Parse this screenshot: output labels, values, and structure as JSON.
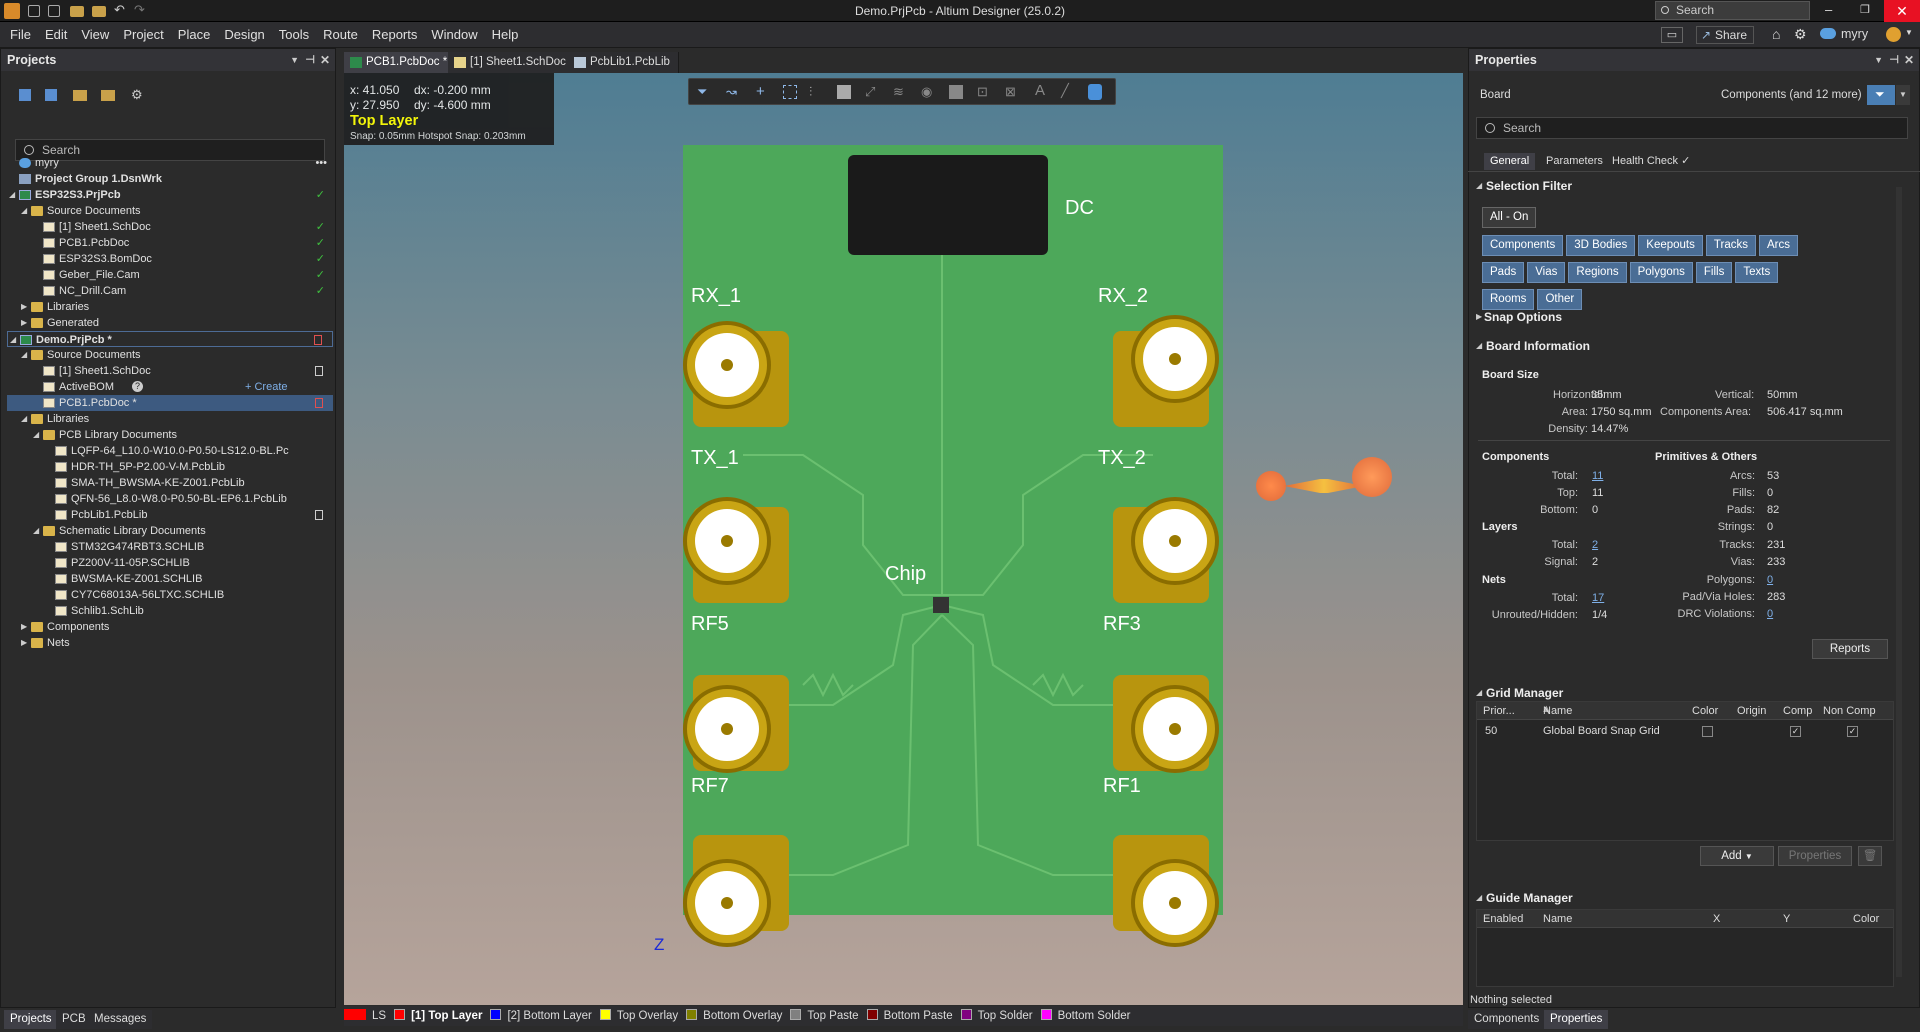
{
  "window": {
    "title": "Demo.PrjPcb - Altium Designer (25.0.2)",
    "search_placeholder": "Search"
  },
  "header_right": {
    "share_label": "Share",
    "user": "myry"
  },
  "menu": [
    "File",
    "Edit",
    "View",
    "Project",
    "Place",
    "Design",
    "Tools",
    "Route",
    "Reports",
    "Window",
    "Help"
  ],
  "projects_panel": {
    "title": "Projects",
    "search_placeholder": "Search",
    "tree": [
      {
        "label": "myry",
        "level": 0
      },
      {
        "label": "Project Group 1.DsnWrk",
        "level": 0
      },
      {
        "label": "ESP32S3.PrjPcb",
        "level": 0
      },
      {
        "label": "Source Documents",
        "level": 1
      },
      {
        "label": "[1] Sheet1.SchDoc",
        "level": 2
      },
      {
        "label": "PCB1.PcbDoc",
        "level": 2
      },
      {
        "label": "ESP32S3.BomDoc",
        "level": 2
      },
      {
        "label": "Geber_File.Cam",
        "level": 2
      },
      {
        "label": "NC_Drill.Cam",
        "level": 2
      },
      {
        "label": "Libraries",
        "level": 1
      },
      {
        "label": "Generated",
        "level": 1
      },
      {
        "label": "Demo.PrjPcb *",
        "level": 0
      },
      {
        "label": "Source Documents",
        "level": 1
      },
      {
        "label": "[1] Sheet1.SchDoc",
        "level": 2
      },
      {
        "label": "ActiveBOM",
        "level": 2
      },
      {
        "label": "PCB1.PcbDoc *",
        "level": 2
      },
      {
        "label": "Libraries",
        "level": 1
      },
      {
        "label": "PCB Library Documents",
        "level": 2
      },
      {
        "label": "LQFP-64_L10.0-W10.0-P0.50-LS12.0-BL.Pc",
        "level": 3
      },
      {
        "label": "HDR-TH_5P-P2.00-V-M.PcbLib",
        "level": 3
      },
      {
        "label": "SMA-TH_BWSMA-KE-Z001.PcbLib",
        "level": 3
      },
      {
        "label": "QFN-56_L8.0-W8.0-P0.50-BL-EP6.1.PcbLib",
        "level": 3
      },
      {
        "label": "PcbLib1.PcbLib",
        "level": 3
      },
      {
        "label": "Schematic Library Documents",
        "level": 2
      },
      {
        "label": "STM32G474RBT3.SCHLIB",
        "level": 3
      },
      {
        "label": "PZ200V-11-05P.SCHLIB",
        "level": 3
      },
      {
        "label": "BWSMA-KE-Z001.SCHLIB",
        "level": 3
      },
      {
        "label": "CY7C68013A-56LTXC.SCHLIB",
        "level": 3
      },
      {
        "label": "Schlib1.SchLib",
        "level": 3
      },
      {
        "label": "Components",
        "level": 1
      },
      {
        "label": "Nets",
        "level": 1
      }
    ],
    "create_label": "+ Create"
  },
  "doc_tabs": [
    "PCB1.PcbDoc *",
    "[1] Sheet1.SchDoc",
    "PcbLib1.PcbLib"
  ],
  "hud": {
    "x": "x: 41.050",
    "dx": "dx: -0.200  mm",
    "y": "y: 27.950",
    "dy": "dy: -4.600  mm",
    "layer": "Top Layer",
    "snap": "Snap: 0.05mm Hotspot Snap: 0.203mm"
  },
  "pcb": {
    "labels": [
      "DC",
      "RX_1",
      "RX_2",
      "TX_1",
      "TX_2",
      "Chip",
      "RF5",
      "RF3",
      "RF7",
      "RF1"
    ],
    "axis": "Z"
  },
  "layers": [
    "LS",
    "[1] Top Layer",
    "[2] Bottom Layer",
    "Top Overlay",
    "Bottom Overlay",
    "Top Paste",
    "Bottom Paste",
    "Top Solder",
    "Bottom Solder"
  ],
  "layer_colors": [
    "#ff0000",
    "#ff0000",
    "#0000ff",
    "#ffff00",
    "#808000",
    "#808080",
    "#800000",
    "#800080",
    "#ff00ff"
  ],
  "bottom_tabs_left": [
    "Projects",
    "PCB",
    "Messages"
  ],
  "properties": {
    "title": "Properties",
    "object": "Board",
    "filter_summary": "Components (and 12 more)",
    "search_placeholder": "Search",
    "tabs": [
      "General",
      "Parameters",
      "Health Check"
    ],
    "selection_filter": "Selection Filter",
    "all_on": "All - On",
    "filters": [
      "Components",
      "3D Bodies",
      "Keepouts",
      "Tracks",
      "Arcs",
      "Pads",
      "Vias",
      "Regions",
      "Polygons",
      "Fills",
      "Texts",
      "Rooms",
      "Other"
    ],
    "snap_options": "Snap Options",
    "board_info": "Board Information",
    "board_size": "Board Size",
    "horizontal_label": "Horizontal:",
    "horizontal": "35mm",
    "vertical_label": "Vertical:",
    "vertical": "50mm",
    "area_label": "Area:",
    "area": "1750 sq.mm",
    "comp_area_label": "Components Area:",
    "comp_area": "506.417 sq.mm",
    "density_label": "Density:",
    "density": "14.47%",
    "components": "Components",
    "prims": "Primitives & Others",
    "total_label": "Total:",
    "comp_total": "11",
    "top_label": "Top:",
    "comp_top": "11",
    "bottom_label": "Bottom:",
    "comp_bottom": "0",
    "layers": "Layers",
    "layers_total": "2",
    "signal_label": "Signal:",
    "layers_signal": "2",
    "nets": "Nets",
    "nets_total": "17",
    "unrouted_label": "Unrouted/Hidden:",
    "unrouted": "1/4",
    "arcs_label": "Arcs:",
    "arcs": "53",
    "fills_label": "Fills:",
    "fills": "0",
    "pads_label": "Pads:",
    "pads": "82",
    "strings_label": "Strings:",
    "strings": "0",
    "tracks_label": "Tracks:",
    "tracks": "231",
    "vias_label": "Vias:",
    "vias": "233",
    "polygons_label": "Polygons:",
    "polygons": "0",
    "holes_label": "Pad/Via Holes:",
    "holes": "283",
    "drc_label": "DRC Violations:",
    "drc": "0",
    "reports_btn": "Reports",
    "grid_manager": "Grid Manager",
    "grid_cols": [
      "Prior...",
      "Name",
      "Color",
      "Origin",
      "Comp",
      "Non Comp"
    ],
    "grid_row": {
      "priority": "50",
      "name": "Global Board Snap Grid"
    },
    "add_btn": "Add",
    "properties_btn": "Properties",
    "guide_manager": "Guide Manager",
    "guide_cols": [
      "Enabled",
      "Name",
      "X",
      "Y",
      "Color"
    ],
    "status": "Nothing selected"
  },
  "bottom_tabs_right": [
    "Components",
    "Properties"
  ]
}
